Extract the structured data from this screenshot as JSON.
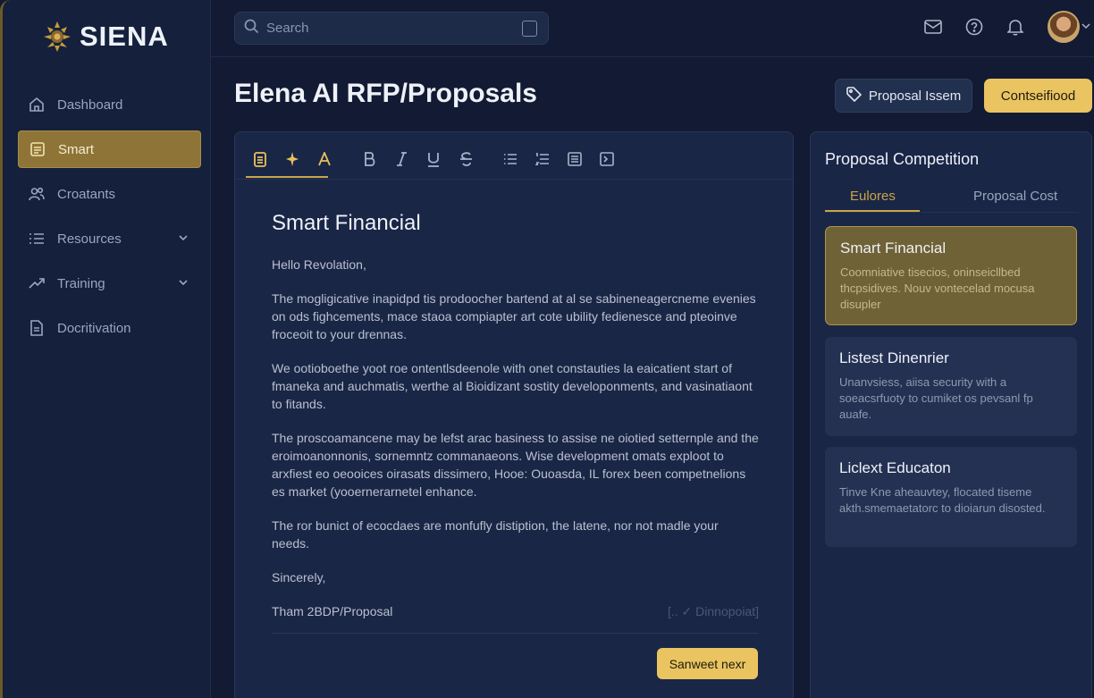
{
  "brand": {
    "name": "SIENA"
  },
  "sidebar": {
    "items": [
      {
        "label": "Dashboard",
        "icon": "home-icon",
        "active": false
      },
      {
        "label": "Smart",
        "icon": "document-icon",
        "active": true
      },
      {
        "label": "Croatants",
        "icon": "users-icon",
        "active": false
      },
      {
        "label": "Resources",
        "icon": "list-icon",
        "active": false,
        "expandable": true
      },
      {
        "label": "Training",
        "icon": "trend-icon",
        "active": false,
        "expandable": true
      },
      {
        "label": "Docritivation",
        "icon": "file-icon",
        "active": false
      }
    ]
  },
  "search": {
    "placeholder": "Search"
  },
  "header": {
    "title": "Elena AI RFP/Proposals",
    "tag_button": "Proposal Issem",
    "primary_button": "Contseifiood"
  },
  "editor": {
    "heading": "Smart Financial",
    "greeting": "Hello Revolation,",
    "paragraphs": [
      "The mogligicative inapidpd tis prodoocher bartend at al se sabineneagercneme evenies on ods fighcements, mace staoa compiapter art cote ubility fedienesce and pteoinve froceoit to your drennas.",
      "We ootioboethe yoot roe ontentlsdeenole with onet constauties la eaicatient start of fmaneka and auchmatis, werthe al Bioidizant sostity developonments, and vasinatiaont to fitands.",
      "The proscoamancene may be lefst arac basiness to assise ne oiotied setternple and the eroimoanonnonis, sornemntz commanaeons. Wise development omats exploot to arxfiest eo oeooices oirasats dissimero, Hooe: Ouoasda, IL forex been competnelions es market (yooernerarnetel enhance.",
      "The ror bunict of ecocdaes are monfufly distiption, the latene, nor not madle your needs."
    ],
    "closing": "Sincerely,",
    "signature": "Tham 2BDP/Proposal",
    "status": "[.. ✓ Dinnopoiat]",
    "save_button": "Sanweet nexr"
  },
  "competition": {
    "title": "Proposal Competition",
    "tabs": [
      {
        "label": "Eulores",
        "active": true
      },
      {
        "label": "Proposal Cost",
        "active": false
      }
    ],
    "cards": [
      {
        "title": "Smart Financial",
        "desc": "Coomniative tisecios, oninseicllbed thcpsidives. Nouv vontecelad mocusa disupler",
        "active": true
      },
      {
        "title": "Listest Dinenrier",
        "desc": "Unanvsiess, aiisa security with a soeacsrfuoty to cumiket os pevsanl fp auafe.",
        "active": false
      },
      {
        "title": "Liclext Educaton",
        "desc": "Tinve Kne aheauvtey, flocated tiseme akth.smemaetatorc to dioiarun disosted.",
        "active": false
      }
    ]
  },
  "colors": {
    "background": "#121b33",
    "accent_gold": "#e9c461",
    "active_item": "#8e7537"
  }
}
